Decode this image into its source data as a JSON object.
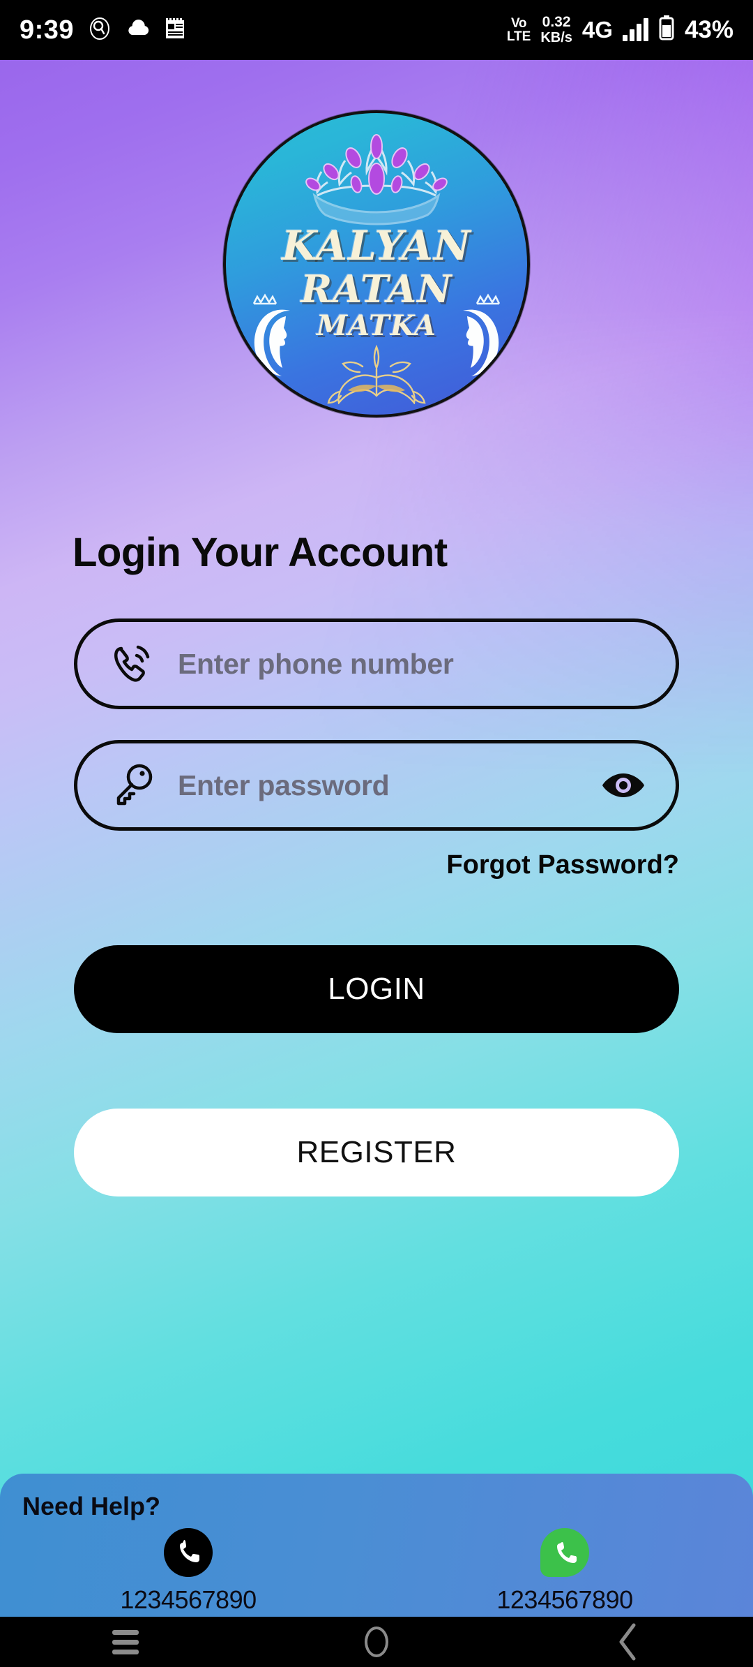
{
  "status_bar": {
    "clock": "9:39",
    "icons_left": [
      "search-circle-icon",
      "cloud-icon",
      "news-icon"
    ],
    "volte_line1": "Vo",
    "volte_line2": "LTE",
    "net_speed_value": "0.32",
    "net_speed_unit": "KB/s",
    "network_type": "4G",
    "signal_bars": 4,
    "battery_percent": "43%"
  },
  "logo": {
    "line1": "KALYAN",
    "line2": "RATAN",
    "line3": "MATKA",
    "gradient_from": "#28bcd4",
    "gradient_to": "#4358d8",
    "text_color": "#f7f1d8"
  },
  "page": {
    "title": "Login Your Account"
  },
  "form": {
    "phone": {
      "placeholder": "Enter phone number",
      "value": "",
      "icon": "phone-in-talk-icon"
    },
    "password": {
      "placeholder": "Enter password",
      "value": "",
      "icon": "key-icon",
      "toggle_icon": "eye-icon"
    },
    "forgot_password_label": "Forgot Password?"
  },
  "actions": {
    "login_label": "LOGIN",
    "register_label": "REGISTER",
    "login_bg": "#000000",
    "login_fg": "#ffffff",
    "register_bg": "#ffffff",
    "register_fg": "#111111"
  },
  "need_help": {
    "title": "Need Help?",
    "contacts": [
      {
        "icon": "phone-icon",
        "number": "1234567890",
        "color": "#000000"
      },
      {
        "icon": "whatsapp-icon",
        "number": "1234567890",
        "color": "#3cc14a"
      }
    ]
  },
  "nav_bar": {
    "recents": "recents-icon",
    "home": "home-icon",
    "back": "back-icon"
  },
  "theme": {
    "bg_top": "#9a67ec",
    "bg_mid": "#c9bdf6",
    "bg_bottom": "#3ad7da",
    "card_bg": "#4a8ed4"
  }
}
